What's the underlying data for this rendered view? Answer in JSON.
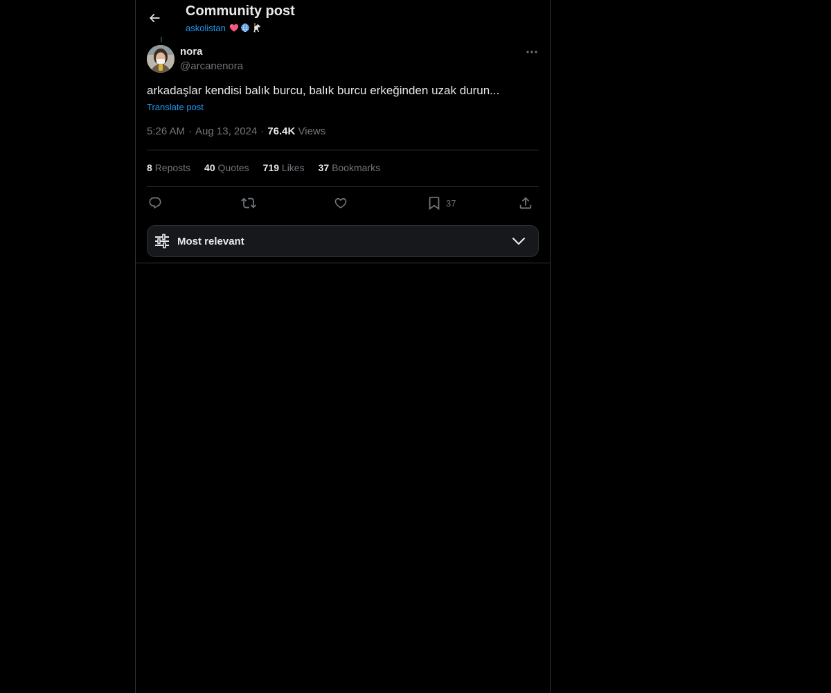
{
  "header": {
    "title": "Community post",
    "community_name": "askolistan",
    "community_emojis": [
      "heart",
      "globe",
      "carousel-horse"
    ]
  },
  "post": {
    "author_name": "nora",
    "author_handle": "@arcanenora",
    "text": "arkadaşlar kendisi balık burcu, balık burcu erkeğinden uzak durun...",
    "translate_label": "Translate post",
    "time": "5:26 AM",
    "date": "Aug 13, 2024",
    "separator": "·",
    "views_count": "76.4K",
    "views_label": "Views"
  },
  "stats": {
    "reposts_count": "8",
    "reposts_label": "Reposts",
    "quotes_count": "40",
    "quotes_label": "Quotes",
    "likes_count": "719",
    "likes_label": "Likes",
    "bookmarks_count": "37",
    "bookmarks_label": "Bookmarks"
  },
  "actions": {
    "bookmark_count": "37"
  },
  "sort": {
    "label": "Most relevant"
  },
  "colors": {
    "background": "#000000",
    "text": "#e7e9ea",
    "muted": "#71767b",
    "accent": "#1d9bf0",
    "border": "#2f3336"
  }
}
